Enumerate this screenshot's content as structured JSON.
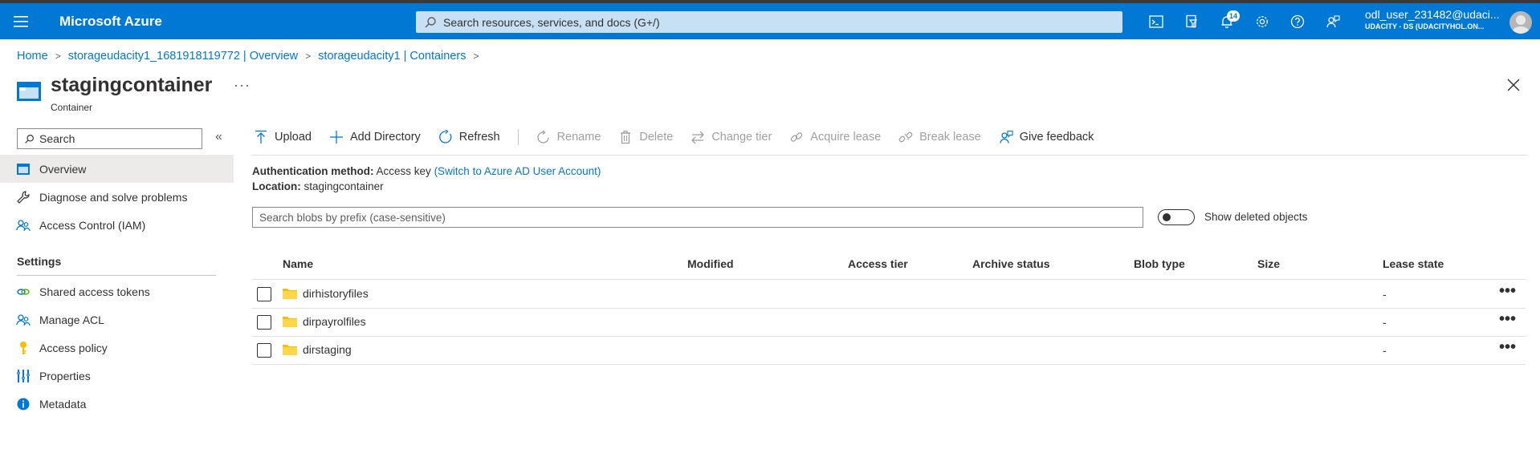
{
  "topbar": {
    "brand": "Microsoft Azure",
    "search_placeholder": "Search resources, services, and docs (G+/)",
    "notification_count": "14",
    "account_name": "odl_user_231482@udaci...",
    "account_directory": "UDACITY - DS (UDACITYHOL.ON..."
  },
  "breadcrumb": {
    "items": [
      "Home",
      "storageudacity1_1681918119772 | Overview",
      "storageudacity1 | Containers"
    ]
  },
  "header": {
    "title": "stagingcontainer",
    "subtitle": "Container",
    "more": "···"
  },
  "sidebar": {
    "search_placeholder": "Search",
    "collapse": "«",
    "items": [
      {
        "label": "Overview",
        "icon": "overview-icon"
      },
      {
        "label": "Diagnose and solve problems",
        "icon": "wrench-icon"
      },
      {
        "label": "Access Control (IAM)",
        "icon": "people-icon"
      }
    ],
    "settings_heading": "Settings",
    "settings_items": [
      {
        "label": "Shared access tokens",
        "icon": "link-icon"
      },
      {
        "label": "Manage ACL",
        "icon": "people-icon"
      },
      {
        "label": "Access policy",
        "icon": "key-icon"
      },
      {
        "label": "Properties",
        "icon": "properties-icon"
      },
      {
        "label": "Metadata",
        "icon": "info-icon"
      }
    ]
  },
  "toolbar": {
    "upload": "Upload",
    "add_directory": "Add Directory",
    "refresh": "Refresh",
    "rename": "Rename",
    "delete": "Delete",
    "change_tier": "Change tier",
    "acquire_lease": "Acquire lease",
    "break_lease": "Break lease",
    "give_feedback": "Give feedback"
  },
  "info": {
    "auth_label": "Authentication method:",
    "auth_value": "Access key",
    "auth_link": "(Switch to Azure AD User Account)",
    "location_label": "Location:",
    "location_value": "stagingcontainer"
  },
  "blob_search_placeholder": "Search blobs by prefix (case-sensitive)",
  "show_deleted_label": "Show deleted objects",
  "table": {
    "headers": [
      "Name",
      "Modified",
      "Access tier",
      "Archive status",
      "Blob type",
      "Size",
      "Lease state"
    ],
    "rows": [
      {
        "name": "dirhistoryfiles",
        "lease_state": "-"
      },
      {
        "name": "dirpayrolfiles",
        "lease_state": "-"
      },
      {
        "name": "dirstaging",
        "lease_state": "-"
      }
    ],
    "row_more": "•••"
  },
  "colors": {
    "azure_blue": "#0078d4",
    "search_bg": "#c7e0f4",
    "folder_yellow": "#f6c000",
    "active_nav": "#edebe9"
  }
}
